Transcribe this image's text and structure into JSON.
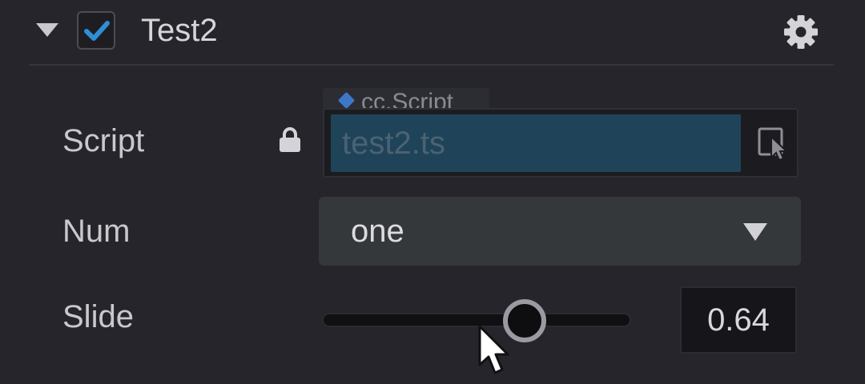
{
  "component": {
    "title": "Test2",
    "enabled": true,
    "collapse_icon": "triangle-down-icon",
    "settings_icon": "gear-icon"
  },
  "properties": {
    "script": {
      "label": "Script",
      "lock_icon": "lock-icon",
      "type_badge": "cc.Script",
      "value": "test2.ts",
      "locate_icon": "locate-asset-icon"
    },
    "num": {
      "label": "Num",
      "selected": "one"
    },
    "slide": {
      "label": "Slide",
      "value": "0.64",
      "level": 0.64
    }
  },
  "colors": {
    "background": "#25252b",
    "accent": "#2e8fd6",
    "script_value_bg": "#1f4459",
    "select_bg": "#34383b"
  }
}
